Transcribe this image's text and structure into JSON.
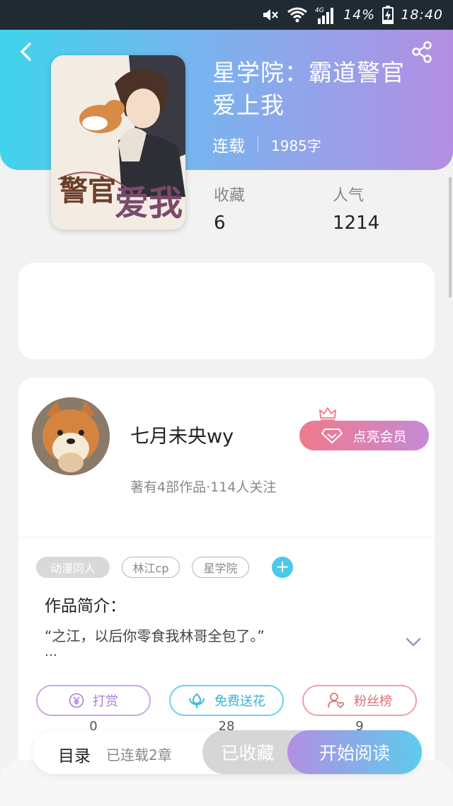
{
  "status_bar": {
    "battery": "14%",
    "time": "18:40",
    "network": "4G"
  },
  "book": {
    "title": "星学院：霸道警官爱上我",
    "status": "连载",
    "word_count": "1985字",
    "cover_title_text": "警官爱上我"
  },
  "stats": [
    {
      "label": "收藏",
      "value": "6"
    },
    {
      "label": "人气",
      "value": "1214"
    }
  ],
  "author": {
    "name": "七月未央wy",
    "stats": "著有4部作品·114人关注",
    "vip_label": "点亮会员"
  },
  "tags": [
    {
      "label": "动漫同人",
      "style": "filled"
    },
    {
      "label": "林江cp",
      "style": "outline"
    },
    {
      "label": "星学院",
      "style": "outline"
    }
  ],
  "intro": {
    "title": "作品简介：",
    "text": "“之江，以后你零食我林哥全包了。”",
    "ellipsis": "…"
  },
  "actions": [
    {
      "label": "打赏",
      "count": "0",
      "icon": "yuan-icon"
    },
    {
      "label": "免费送花",
      "count": "28",
      "icon": "flower-icon"
    },
    {
      "label": "粉丝榜",
      "count": "9",
      "icon": "fan-icon"
    }
  ],
  "bottom": {
    "toc_label": "目录",
    "toc_info": "已连载2章",
    "collected_label": "已收藏",
    "read_label": "开始阅读"
  },
  "colors": {
    "header_gradient_start": "#3fd4ec",
    "header_gradient_end": "#b38ee3",
    "accent_cyan": "#49c9ec",
    "vip_pink": "#f07a8a"
  }
}
